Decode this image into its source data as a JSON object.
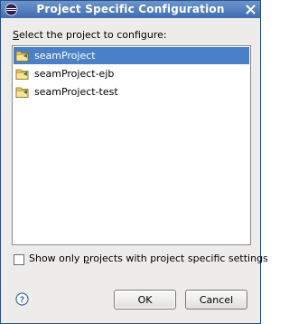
{
  "window": {
    "title": "Project Specific Configuration",
    "title_icon": "eclipse-icon",
    "close_icon": "close-icon"
  },
  "prompt": {
    "mnemonic": "S",
    "rest": "elect the project to configure:"
  },
  "projects": [
    {
      "label": "seamProject",
      "icon": "project-folder-icon",
      "selected": true
    },
    {
      "label": "seamProject-ejb",
      "icon": "project-folder-icon",
      "selected": false
    },
    {
      "label": "seamProject-test",
      "icon": "project-folder-icon",
      "selected": false
    }
  ],
  "filter": {
    "label_before": "Show only ",
    "mnemonic": "p",
    "label_after": "rojects with project specific settings",
    "checked": false
  },
  "buttons": {
    "ok": "OK",
    "cancel": "Cancel"
  },
  "colors": {
    "titlebar": "#3f6db0",
    "selection": "#4a80c8"
  }
}
